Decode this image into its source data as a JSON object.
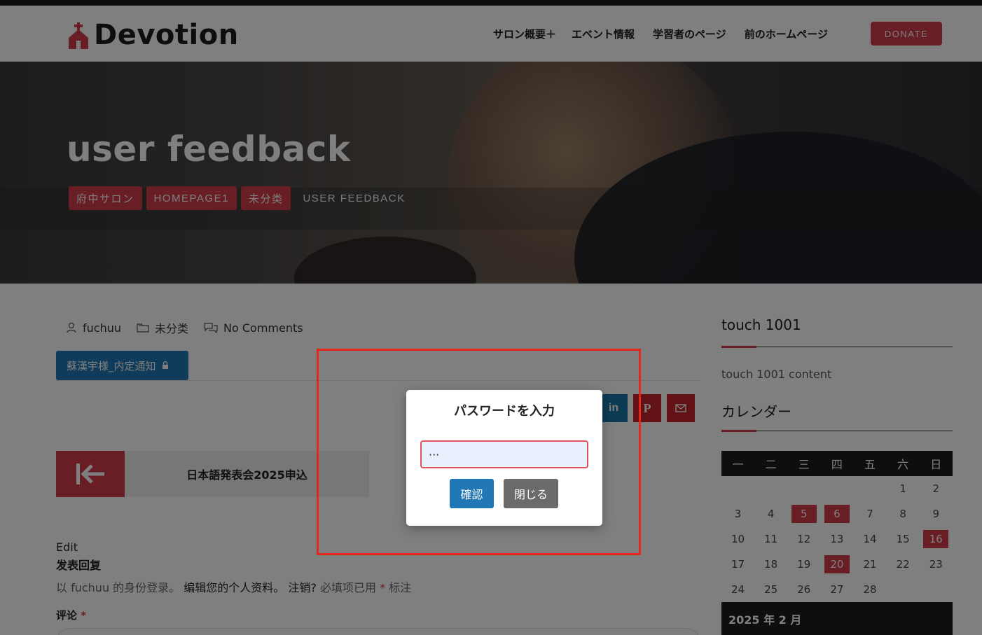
{
  "header": {
    "logo_text": "Devotion",
    "nav": [
      {
        "label": "サロン概要＋"
      },
      {
        "label": "エベント情報"
      },
      {
        "label": "学習者のページ"
      },
      {
        "label": "前のホームページ"
      }
    ],
    "donate_label": "DONATE"
  },
  "hero": {
    "title": "user feedback",
    "breadcrumbs": [
      "府中サロン",
      "HOMEPAGE1",
      "未分类",
      "USER FEEDBACK"
    ]
  },
  "post": {
    "author": "fuchuu",
    "category": "未分类",
    "comments": "No Comments",
    "protected_button_label": "蘇漢宇様_内定通知",
    "share_icons": [
      "linkedin-icon",
      "pinterest-icon",
      "email-icon"
    ],
    "prev_post_title": "日本語発表会2025申込"
  },
  "comment_section": {
    "edit_label": "Edit",
    "reply_title": "发表回复",
    "login_prefix": "以 fuchuu 的身份登录。",
    "edit_profile_link": "编辑您的个人资料",
    "sep": "。",
    "logout_link": "注销?",
    "required_note_prefix": " 必填项已用 ",
    "required_star": "*",
    "required_note_suffix": " 标注",
    "comment_label": "评论",
    "comment_star": "*"
  },
  "sidebar": {
    "widget1_title": "touch 1001",
    "widget1_text": "touch 1001 content",
    "widget2_title": "カレンダー",
    "calendar": {
      "weekdays": [
        "一",
        "二",
        "三",
        "四",
        "五",
        "六",
        "日"
      ],
      "weeks": [
        [
          "",
          "",
          "",
          "",
          "",
          "1",
          "2"
        ],
        [
          "3",
          "4",
          "5",
          "6",
          "7",
          "8",
          "9"
        ],
        [
          "10",
          "11",
          "12",
          "13",
          "14",
          "15",
          "16"
        ],
        [
          "17",
          "18",
          "19",
          "20",
          "21",
          "22",
          "23"
        ],
        [
          "24",
          "25",
          "26",
          "27",
          "28",
          "",
          ""
        ]
      ],
      "highlighted": [
        "5",
        "6",
        "16",
        "20"
      ],
      "footer": "2025 年 2 月"
    }
  },
  "modal": {
    "title": "パスワードを入力",
    "password_value": "···",
    "confirm_label": "確認",
    "close_label": "閉じる"
  },
  "colors": {
    "accent": "#d23c4a",
    "primary_button": "#2177b5",
    "annotation_box": "#e4261c"
  }
}
